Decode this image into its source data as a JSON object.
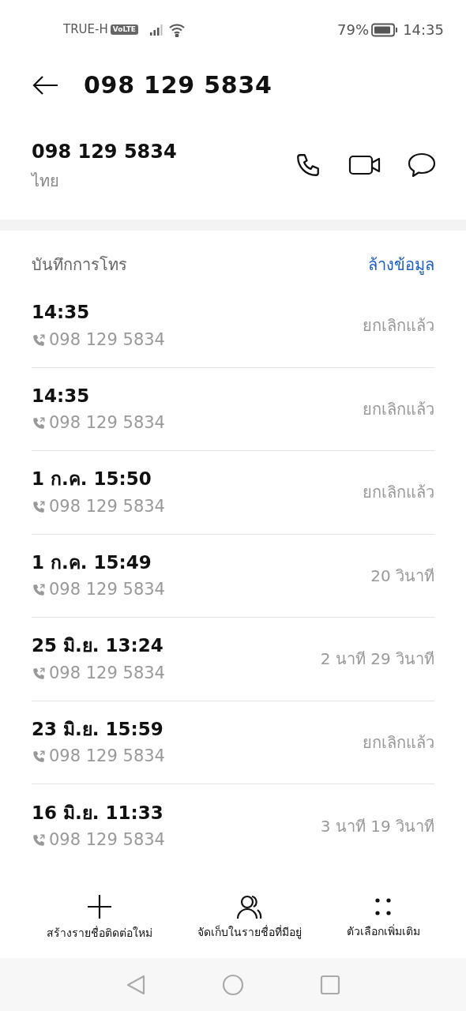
{
  "status_bar": {
    "carrier": "TRUE-H",
    "volte": "VoLTE",
    "battery_percent": "79%",
    "time": "14:35"
  },
  "header": {
    "title": "098 129 5834"
  },
  "contact": {
    "number": "098 129 5834",
    "location": "ไทย"
  },
  "call_log": {
    "title": "บันทึกการโทร",
    "clear": "ล้างข้อมูล",
    "entries": [
      {
        "time": "14:35",
        "number": "098 129 5834",
        "status": "ยกเลิกแล้ว"
      },
      {
        "time": "14:35",
        "number": "098 129 5834",
        "status": "ยกเลิกแล้ว"
      },
      {
        "time": "1 ก.ค. 15:50",
        "number": "098 129 5834",
        "status": "ยกเลิกแล้ว"
      },
      {
        "time": "1 ก.ค. 15:49",
        "number": "098 129 5834",
        "status": "20 วินาที"
      },
      {
        "time": "25 มิ.ย. 13:24",
        "number": "098 129 5834",
        "status": "2 นาที 29 วินาที"
      },
      {
        "time": "23 มิ.ย. 15:59",
        "number": "098 129 5834",
        "status": "ยกเลิกแล้ว"
      },
      {
        "time": "16 มิ.ย. 11:33",
        "number": "098 129 5834",
        "status": "3 นาที 19 วินาที"
      }
    ]
  },
  "bottom_actions": [
    {
      "kind": "add",
      "label": "สร้างรายชื่อติดต่อใหม่"
    },
    {
      "kind": "contacts",
      "label": "จัดเก็บในรายชื่อที่มีอยู่"
    },
    {
      "kind": "more",
      "label": "ตัวเลือกเพิ่มเติม"
    }
  ]
}
